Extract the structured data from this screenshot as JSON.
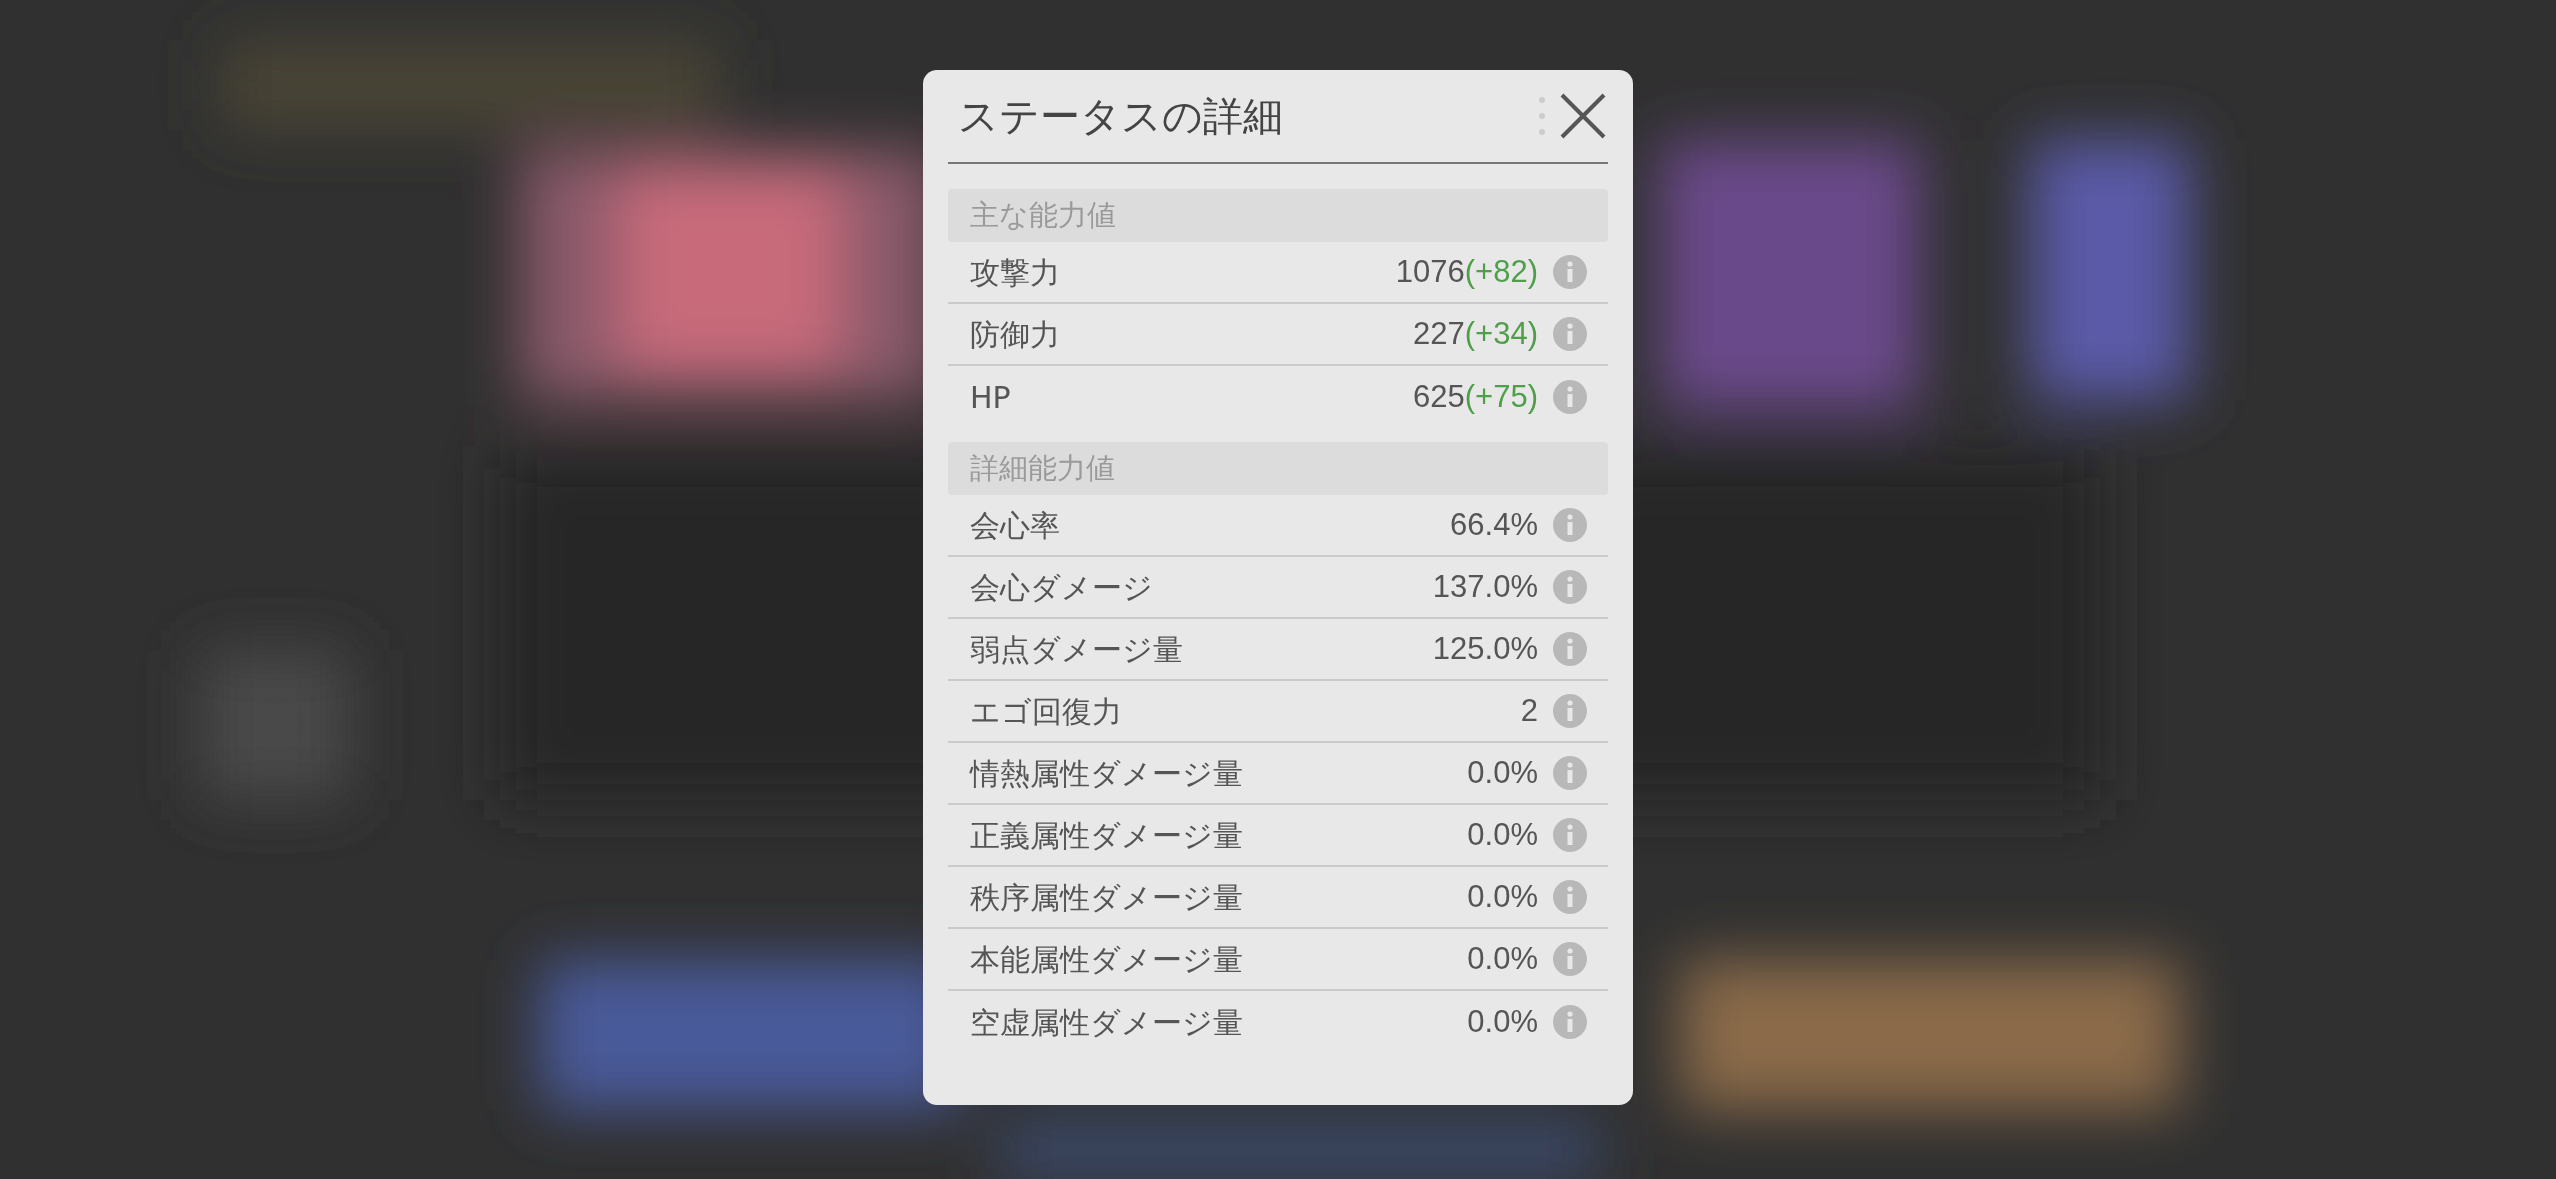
{
  "dialog": {
    "title": "ステータスの詳細",
    "sections": [
      {
        "heading": "主な能力値",
        "rows": [
          {
            "label": "攻撃力",
            "value": "1076",
            "bonus": "(+82)"
          },
          {
            "label": "防御力",
            "value": "227",
            "bonus": "(+34)"
          },
          {
            "label": "HP",
            "value": "625",
            "bonus": "(+75)"
          }
        ]
      },
      {
        "heading": "詳細能力値",
        "rows": [
          {
            "label": "会心率",
            "value": "66.4%"
          },
          {
            "label": "会心ダメージ",
            "value": "137.0%"
          },
          {
            "label": "弱点ダメージ量",
            "value": "125.0%"
          },
          {
            "label": "エゴ回復力",
            "value": "2"
          },
          {
            "label": "情熱属性ダメージ量",
            "value": "0.0%"
          },
          {
            "label": "正義属性ダメージ量",
            "value": "0.0%"
          },
          {
            "label": "秩序属性ダメージ量",
            "value": "0.0%"
          },
          {
            "label": "本能属性ダメージ量",
            "value": "0.0%"
          },
          {
            "label": "空虚属性ダメージ量",
            "value": "0.0%"
          }
        ]
      }
    ]
  }
}
